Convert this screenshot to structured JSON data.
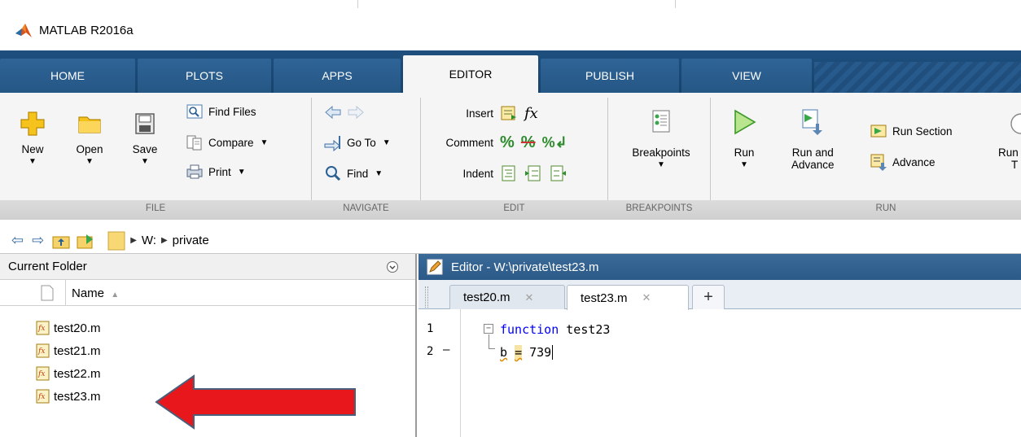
{
  "window": {
    "title": "MATLAB R2016a"
  },
  "tabs": [
    {
      "label": "HOME"
    },
    {
      "label": "PLOTS"
    },
    {
      "label": "APPS"
    },
    {
      "label": "EDITOR",
      "active": true
    },
    {
      "label": "PUBLISH"
    },
    {
      "label": "VIEW"
    }
  ],
  "ribbon": {
    "file": {
      "group_label": "FILE",
      "new": "New",
      "open": "Open",
      "save": "Save",
      "find_files": "Find Files",
      "compare": "Compare",
      "print": "Print"
    },
    "navigate": {
      "group_label": "NAVIGATE",
      "go_to": "Go To",
      "find": "Find"
    },
    "edit": {
      "group_label": "EDIT",
      "insert": "Insert",
      "comment": "Comment",
      "indent": "Indent",
      "fx": "fx"
    },
    "breakpoints": {
      "group_label": "BREAKPOINTS",
      "breakpoints": "Breakpoints"
    },
    "run": {
      "group_label": "RUN",
      "run": "Run",
      "run_and_advance_1": "Run and",
      "run_and_advance_2": "Advance",
      "run_section": "Run Section",
      "advance": "Advance",
      "cut_1": "Run",
      "cut_2": "T"
    }
  },
  "address": {
    "drive": "W:",
    "folder": "private"
  },
  "current_folder": {
    "title": "Current Folder",
    "column_name": "Name",
    "sort_indicator": "▲",
    "files": [
      "test20.m",
      "test21.m",
      "test22.m",
      "test23.m"
    ]
  },
  "editor": {
    "title": "Editor - W:\\private\\test23.m",
    "tabs": [
      {
        "label": "test20.m",
        "close": "✕"
      },
      {
        "label": "test23.m",
        "close": "✕",
        "active": true
      }
    ],
    "add_tab": "+",
    "lines": [
      {
        "num": "1",
        "marker": "",
        "keyword": "function",
        "rest": " test23"
      },
      {
        "num": "2",
        "marker": "–",
        "var": "b",
        "op": "=",
        "rest": " 739"
      }
    ]
  },
  "colors": {
    "tab_strip": "#1e4f7e",
    "editor_title": "#2c5a88",
    "keyword": "#0000ff",
    "arrow": "#e8171c"
  }
}
